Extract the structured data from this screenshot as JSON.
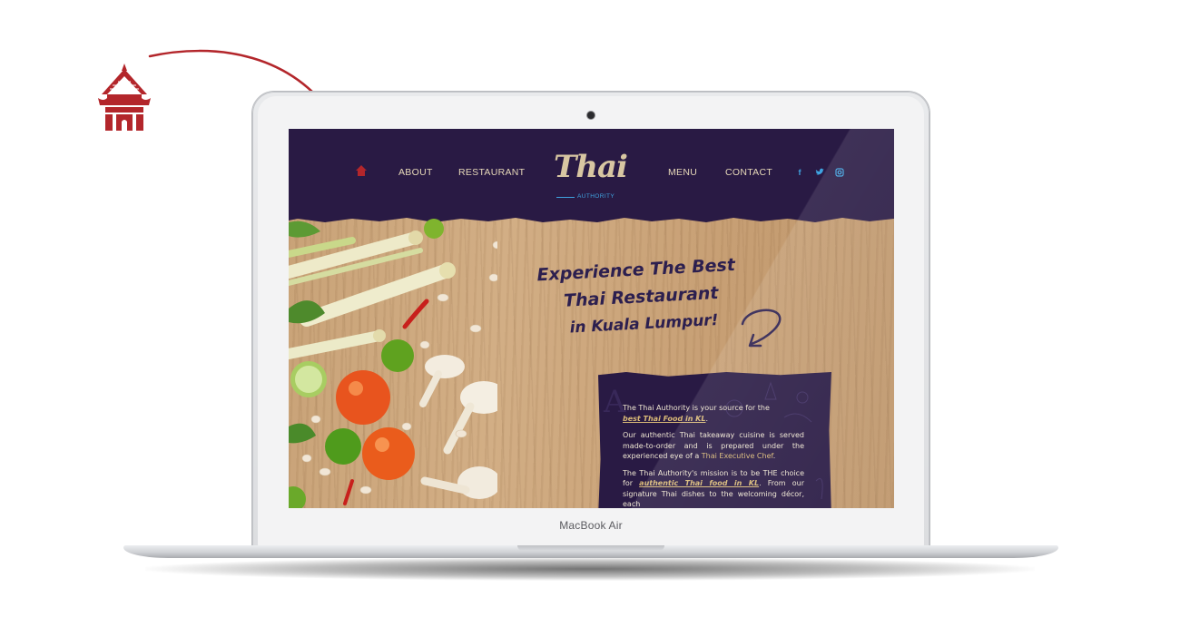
{
  "laptop": {
    "model_label": "MacBook Air"
  },
  "site": {
    "nav": {
      "home_icon": "thai-house-icon",
      "items_left": [
        "ABOUT",
        "RESTAURANT"
      ],
      "items_right": [
        "MENU",
        "CONTACT"
      ],
      "logo_text": "Thai",
      "logo_subtext": "AUTHORITY",
      "social_icons": [
        "facebook-icon",
        "twitter-icon",
        "instagram-icon"
      ]
    },
    "hero": {
      "headline_line1": "Experience The Best",
      "headline_line2": "Thai Restaurant",
      "headline_line3": "in Kuala Lumpur!"
    },
    "card": {
      "p1_text": "The Thai Authority is your source for the",
      "p1_link": "best Thai Food in KL",
      "p1_end": ".",
      "p2_text": "Our authentic Thai takeaway cuisine is served made-to-order and is prepared under the experienced eye of a",
      "p2_accent": "Thai Executive Chef",
      "p2_end": ".",
      "p3_text": "The Thai Authority's mission is to be THE choice for",
      "p3_link": "authentic Thai food in KL",
      "p3_end": ". From our signature Thai dishes to the welcoming décor, each"
    }
  },
  "colors": {
    "nav_bg": "#291a44",
    "nav_text": "#e7d9b9",
    "social_blue": "#3fa3e0",
    "accent_red": "#b3262b",
    "headline": "#2c1f4f"
  }
}
